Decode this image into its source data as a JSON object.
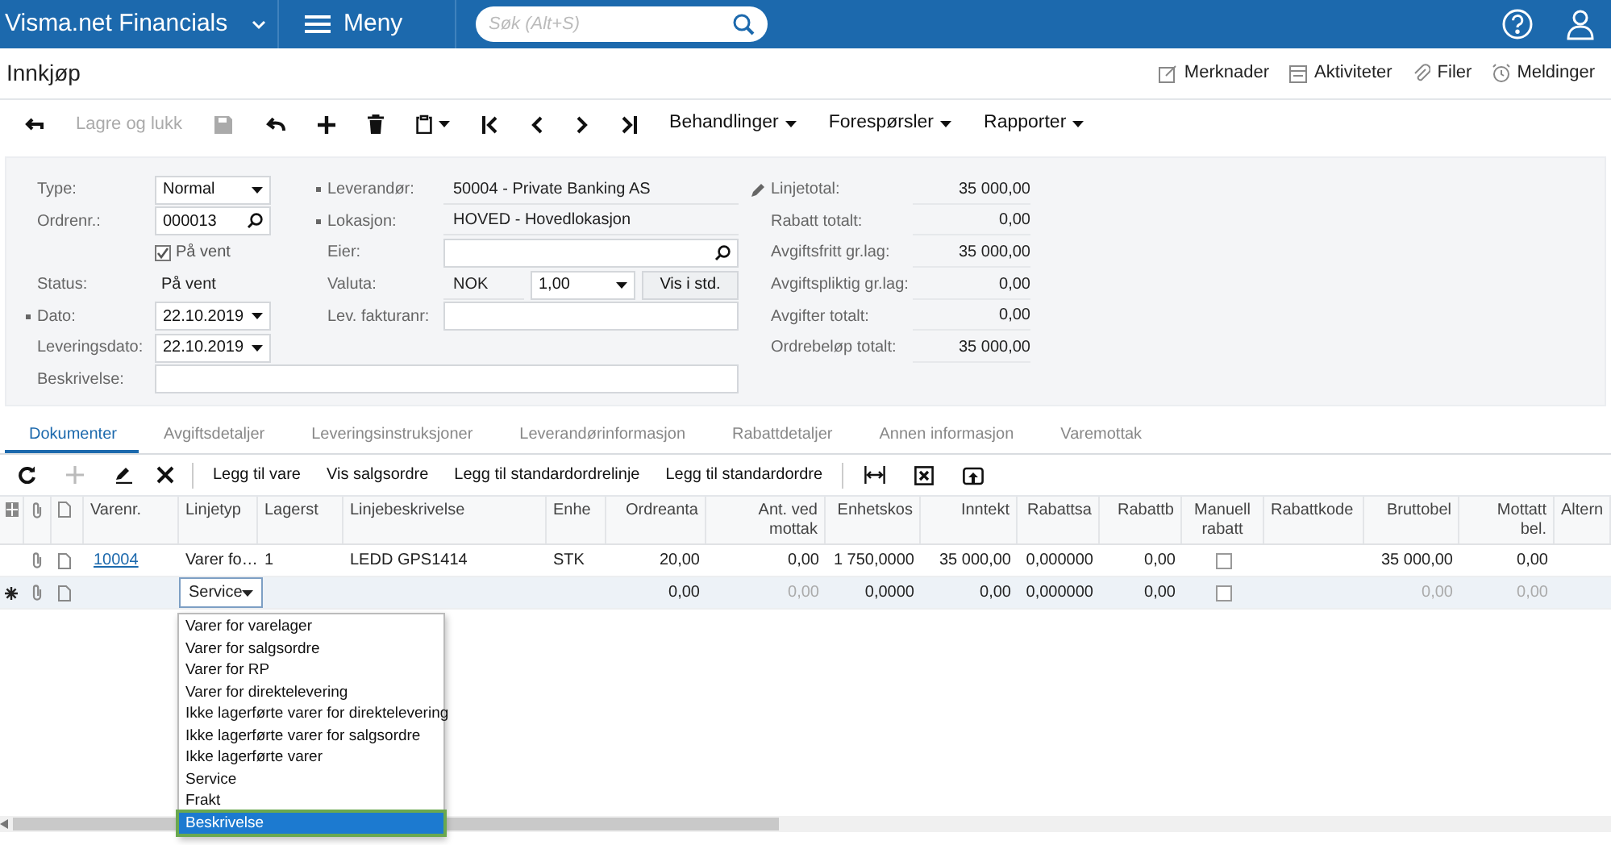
{
  "app": {
    "brand": "Visma.net Financials",
    "menu": "Meny",
    "search": {
      "placeholder": "Søk (Alt+S)"
    }
  },
  "page": {
    "title": "Innkjøp",
    "links": [
      {
        "kind": "notes",
        "label": "Merknader"
      },
      {
        "kind": "activities",
        "label": "Aktiviteter"
      },
      {
        "kind": "files",
        "label": "Filer"
      },
      {
        "kind": "alerts",
        "label": "Meldinger"
      }
    ]
  },
  "toolbar": {
    "save_close": {
      "label": "Lagre og lukk",
      "disabled": true
    },
    "save": {
      "disabled": true
    },
    "menus": [
      "Behandlinger",
      "Forespørsler",
      "Rapporter"
    ]
  },
  "form": {
    "left": [
      {
        "kind": "select",
        "label": "Type:",
        "value": "Normal",
        "required": false
      },
      {
        "kind": "lookup",
        "label": "Ordrenr.:",
        "value": "000013",
        "required": false
      },
      {
        "kind": "checkbox",
        "label": "På vent",
        "checked": true
      },
      {
        "kind": "text",
        "label": "Status:",
        "value": "På vent",
        "required": false
      },
      {
        "kind": "select",
        "label": "Dato:",
        "value": "22.10.2019",
        "required": true
      },
      {
        "kind": "select",
        "label": "Leveringsdato:",
        "value": "22.10.2019",
        "required": false
      }
    ],
    "middle": [
      {
        "kind": "editable",
        "label": "Leverandør:",
        "value": "50004 - Private Banking AS",
        "required": true
      },
      {
        "kind": "display",
        "label": "Lokasjon:",
        "value": "HOVED - Hovedlokasjon",
        "required": true
      },
      {
        "kind": "lookup",
        "label": "Eier:",
        "required": false
      },
      {
        "kind": "currency",
        "label": "Valuta:",
        "code": "NOK",
        "rate": "1,00",
        "button": "Vis i std.",
        "required": false
      },
      {
        "kind": "input",
        "label": "Lev. fakturanr:",
        "required": false
      }
    ],
    "description": {
      "kind": "input",
      "label": "Beskrivelse:",
      "required": false
    },
    "totals": [
      {
        "label": "Linjetotal:",
        "value": "35 000,00"
      },
      {
        "label": "Rabatt totalt:",
        "value": "0,00"
      },
      {
        "label": "Avgiftsfritt gr.lag:",
        "value": "35 000,00"
      },
      {
        "label": "Avgiftspliktig gr.lag:",
        "value": "0,00"
      },
      {
        "label": "Avgifter totalt:",
        "value": "0,00"
      },
      {
        "label": "Ordrebeløp totalt:",
        "value": "35 000,00"
      }
    ]
  },
  "tabs": [
    {
      "label": "Dokumenter",
      "selected": true
    },
    {
      "label": "Avgiftsdetaljer",
      "selected": false
    },
    {
      "label": "Leveringsinstruksjoner",
      "selected": false
    },
    {
      "label": "Leverandørinformasjon",
      "selected": false
    },
    {
      "label": "Rabattdetaljer",
      "selected": false
    },
    {
      "label": "Annen informasjon",
      "selected": false
    },
    {
      "label": "Varemottak",
      "selected": false
    }
  ],
  "grid_toolbar": {
    "add": {
      "disabled": true
    },
    "actions": [
      "Legg til vare",
      "Vis salgsordre",
      "Legg til standardordrelinje",
      "Legg til standardordre"
    ]
  },
  "table": {
    "columns": [
      "Varenr.",
      "Linjetyp",
      "Lagerst",
      "Linjebeskrivelse",
      "Enhe",
      "Ordreanta",
      "Ant. ved mottak",
      "Enhetskos",
      "Inntekt",
      "Rabattsa",
      "Rabattb",
      "Manuell rabatt",
      "Rabattkode",
      "Bruttobel",
      "Mottatt bel.",
      "Altern"
    ],
    "rows": [
      {
        "new": false,
        "cells": [
          {
            "kind": "link",
            "text": "10004"
          },
          "Varer fo…",
          "1",
          "LEDD GPS1414",
          "STK",
          "20,00",
          "0,00",
          "1 750,0000",
          "35 000,00",
          "0,000000",
          "0,00",
          {
            "kind": "checkbox",
            "checked": false
          },
          null,
          "35 000,00",
          "0,00",
          null
        ]
      },
      {
        "new": true,
        "cells": [
          null,
          {
            "kind": "select",
            "text": "Service"
          },
          null,
          null,
          null,
          "0,00",
          {
            "kind": "muted",
            "text": "0,00"
          },
          "0,0000",
          "0,00",
          "0,000000",
          "0,00",
          {
            "kind": "checkbox",
            "checked": false
          },
          null,
          {
            "kind": "muted",
            "text": "0,00"
          },
          {
            "kind": "muted",
            "text": "0,00"
          },
          null
        ]
      }
    ]
  },
  "dropdown": {
    "items": [
      {
        "label": "Varer for varelager",
        "selected": false
      },
      {
        "label": "Varer for salgsordre",
        "selected": false
      },
      {
        "label": "Varer for RP",
        "selected": false
      },
      {
        "label": "Varer for direktelevering",
        "selected": false
      },
      {
        "label": "Ikke lagerførte varer for direktelevering",
        "selected": false
      },
      {
        "label": "Ikke lagerførte varer for salgsordre",
        "selected": false
      },
      {
        "label": "Ikke lagerførte varer",
        "selected": false
      },
      {
        "label": "Service",
        "selected": false
      },
      {
        "label": "Frakt",
        "selected": false
      },
      {
        "label": "Beskrivelse",
        "selected": true
      }
    ]
  }
}
